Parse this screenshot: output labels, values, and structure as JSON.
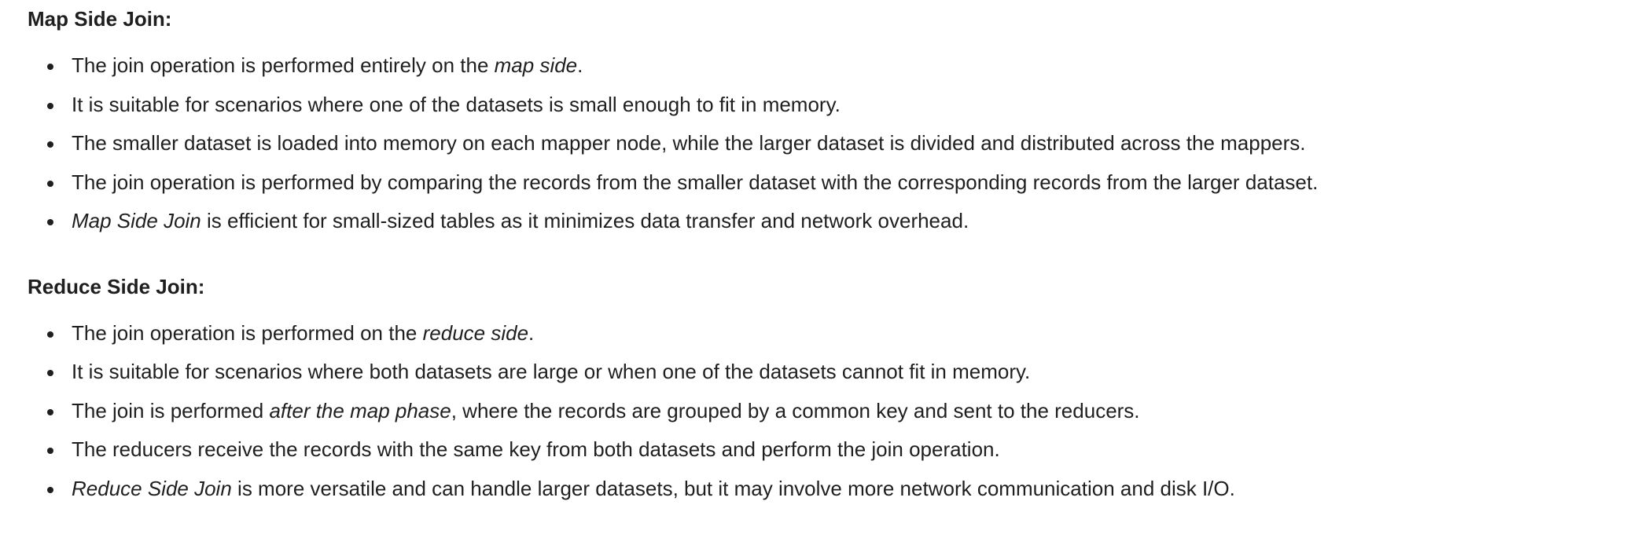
{
  "sections": [
    {
      "heading": "Map Side Join:",
      "items": [
        {
          "before": "The join operation is performed entirely on the ",
          "em": "map side",
          "after": "."
        },
        {
          "before": "It is suitable for scenarios where one of the datasets is small enough to fit in memory.",
          "em": "",
          "after": ""
        },
        {
          "before": "The smaller dataset is loaded into memory on each mapper node, while the larger dataset is divided and distributed across the mappers.",
          "em": "",
          "after": ""
        },
        {
          "before": "The join operation is performed by comparing the records from the smaller dataset with the corresponding records from the larger dataset.",
          "em": "",
          "after": ""
        },
        {
          "before": "",
          "em": "Map Side Join",
          "after": " is efficient for small-sized tables as it minimizes data transfer and network overhead."
        }
      ]
    },
    {
      "heading": "Reduce Side Join:",
      "items": [
        {
          "before": "The join operation is performed on the ",
          "em": "reduce side",
          "after": "."
        },
        {
          "before": "It is suitable for scenarios where both datasets are large or when one of the datasets cannot fit in memory.",
          "em": "",
          "after": ""
        },
        {
          "before": "The join is performed ",
          "em": "after the map phase",
          "after": ", where the records are grouped by a common key and sent to the reducers."
        },
        {
          "before": "The reducers receive the records with the same key from both datasets and perform the join operation.",
          "em": "",
          "after": ""
        },
        {
          "before": "",
          "em": "Reduce Side Join",
          "after": " is more versatile and can handle larger datasets, but it may involve more network communication and disk I/O."
        }
      ]
    }
  ]
}
